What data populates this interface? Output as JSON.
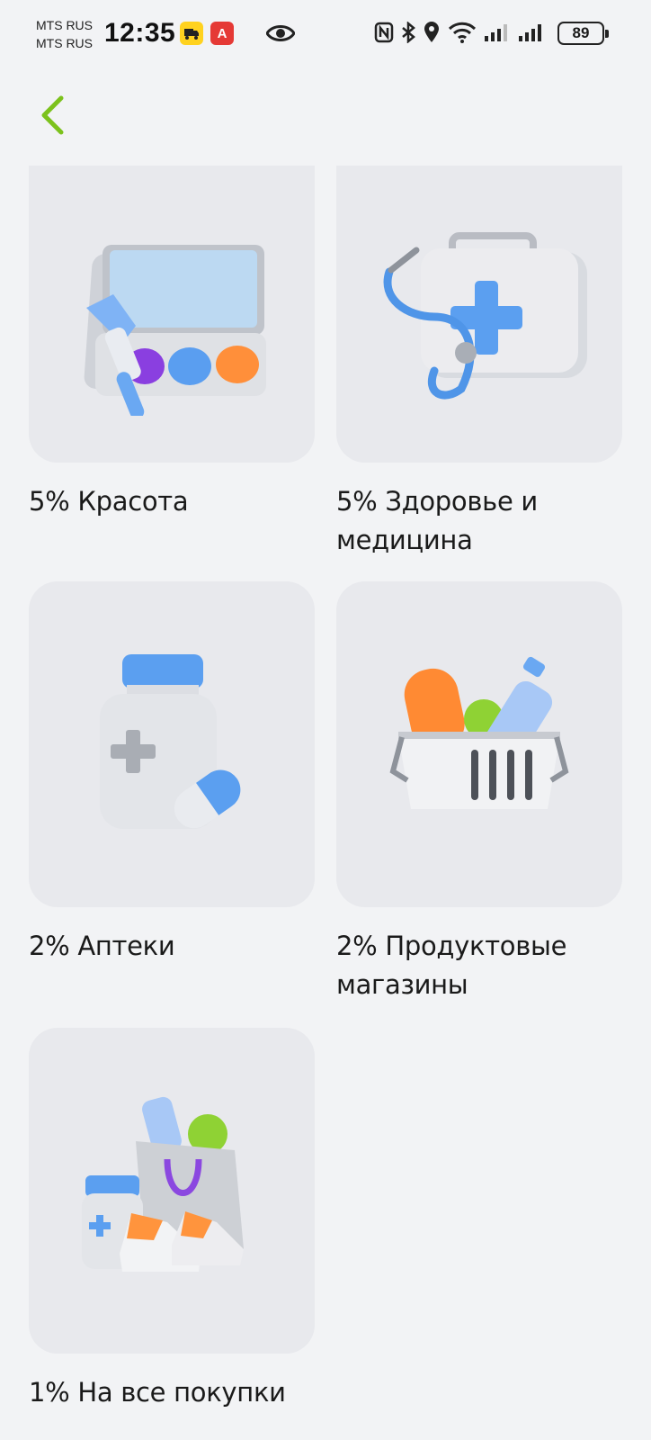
{
  "status_bar": {
    "carrier_1": "MTS RUS",
    "carrier_2": "MTS RUS",
    "time": "12:35",
    "notif_red_letter": "A",
    "battery": "89"
  },
  "colors": {
    "accent": "#7cc21c",
    "background": "#f2f3f5",
    "tile": "#e8e9ed"
  },
  "categories": [
    {
      "label": "5% Красота",
      "icon": "makeup-palette-icon"
    },
    {
      "label": "5% Здоровье и медицина",
      "icon": "medical-kit-icon"
    },
    {
      "label": "2% Аптеки",
      "icon": "pill-bottle-icon"
    },
    {
      "label": "2% Продуктовые магазины",
      "icon": "grocery-basket-icon"
    },
    {
      "label": "1% На все покупки",
      "icon": "shopping-bag-icon"
    }
  ]
}
